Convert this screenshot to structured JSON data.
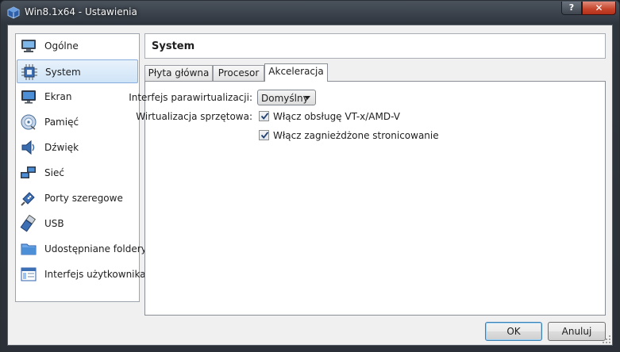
{
  "window": {
    "title": "Win8.1x64 - Ustawienia",
    "help_glyph": "?",
    "close_glyph": "✕"
  },
  "sidebar": {
    "items": [
      {
        "label": "Ogólne",
        "icon": "monitor-icon"
      },
      {
        "label": "System",
        "icon": "chip-icon",
        "selected": true
      },
      {
        "label": "Ekran",
        "icon": "display-icon"
      },
      {
        "label": "Pamięć",
        "icon": "disk-icon"
      },
      {
        "label": "Dźwięk",
        "icon": "speaker-icon"
      },
      {
        "label": "Sieć",
        "icon": "network-icon"
      },
      {
        "label": "Porty szeregowe",
        "icon": "serial-port-icon"
      },
      {
        "label": "USB",
        "icon": "usb-icon"
      },
      {
        "label": "Udostępniane foldery",
        "icon": "folder-icon"
      },
      {
        "label": "Interfejs użytkownika",
        "icon": "ui-window-icon"
      }
    ]
  },
  "main": {
    "title": "System",
    "tabs": [
      {
        "label": "Płyta główna"
      },
      {
        "label": "Procesor"
      },
      {
        "label": "Akceleracja",
        "active": true
      }
    ],
    "paravirt": {
      "label": "Interfejs parawirtualizacji:",
      "value": "Domyślny"
    },
    "hw_virt": {
      "label": "Wirtualizacja sprzętowa:",
      "enable_vtx_label": "Włącz obsługę VT-x/AMD-V",
      "enable_vtx_checked": true,
      "nested_paging_label": "Włącz zagnieżdżone stronicowanie",
      "nested_paging_checked": true
    }
  },
  "buttons": {
    "ok": "OK",
    "cancel": "Anuluj"
  },
  "colors": {
    "selection_border": "#84acdd",
    "close_button": "#c4442a",
    "titlebar": "#2f353d"
  }
}
